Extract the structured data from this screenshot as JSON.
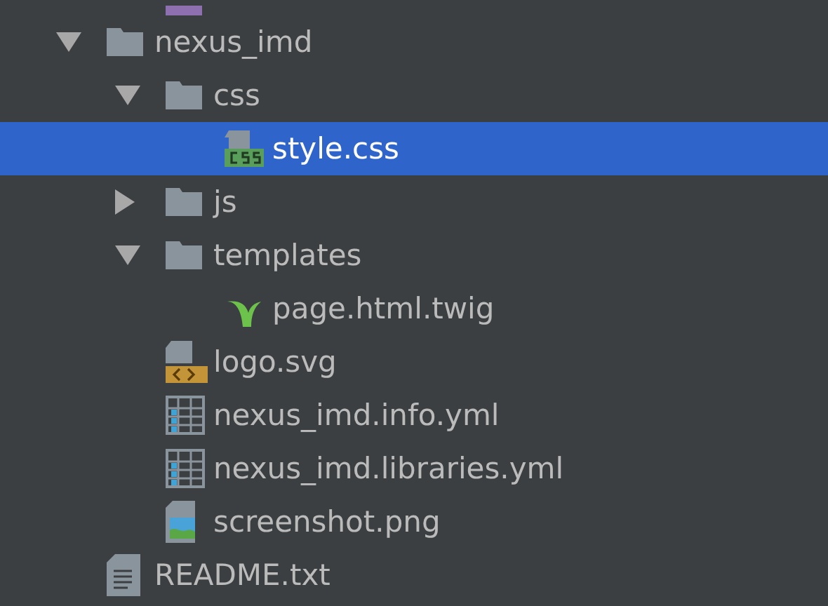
{
  "cut_off_item": {
    "kind": "php"
  },
  "tree": [
    {
      "name": "nexus_imd",
      "kind": "folder",
      "expanded": true,
      "selected": false,
      "children": [
        {
          "name": "css",
          "kind": "folder",
          "expanded": true,
          "selected": false,
          "children": [
            {
              "name": "style.css",
              "kind": "css",
              "selected": true
            }
          ]
        },
        {
          "name": "js",
          "kind": "folder",
          "expanded": false,
          "selected": false
        },
        {
          "name": "templates",
          "kind": "folder",
          "expanded": true,
          "selected": false,
          "children": [
            {
              "name": "page.html.twig",
              "kind": "twig",
              "selected": false
            }
          ]
        },
        {
          "name": "logo.svg",
          "kind": "svg",
          "selected": false
        },
        {
          "name": "nexus_imd.info.yml",
          "kind": "yml",
          "selected": false
        },
        {
          "name": "nexus_imd.libraries.yml",
          "kind": "yml",
          "selected": false
        },
        {
          "name": "screenshot.png",
          "kind": "png",
          "selected": false
        }
      ]
    },
    {
      "name": "README.txt",
      "kind": "txt",
      "selected": false
    }
  ]
}
